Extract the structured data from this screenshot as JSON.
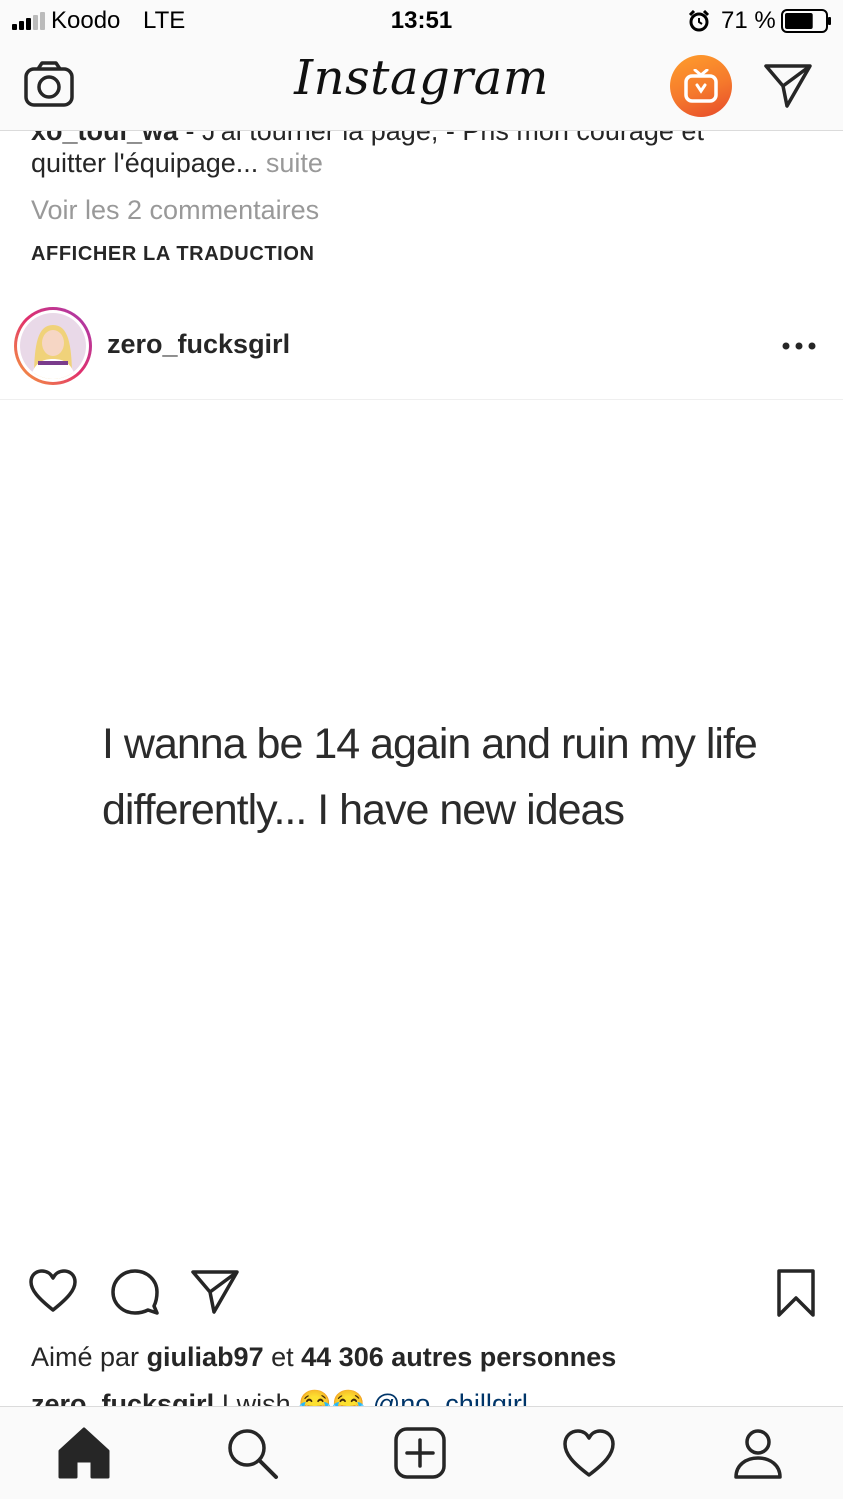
{
  "status_bar": {
    "carrier": "Koodo",
    "network": "LTE",
    "time": "13:51",
    "battery_percent": "71 %",
    "battery_level": 0.71,
    "icons": [
      "signal-icon",
      "alarm-icon",
      "battery-icon"
    ]
  },
  "header": {
    "title": "Instagram",
    "icons": [
      "camera-icon",
      "igtv-icon",
      "direct-message-icon"
    ],
    "igtv_color": "#f5792c"
  },
  "previous_post": {
    "cut_username": "xo_toui_wa",
    "cut_text": " - J'ai tourner la page, - Pris mon courage et",
    "caption_line": "quitter l'équipage...",
    "more_label": "suite",
    "view_comments": "Voir les 2 commentaires",
    "translate_label": "AFFICHER LA TRADUCTION"
  },
  "post": {
    "username": "zero_fucksgirl",
    "options_icon": "more-options-icon",
    "image_text_line1": "I wanna be 14 again and ruin my life",
    "image_text_line2": "differently... I have new ideas",
    "liked_by_prefix": "Aimé par",
    "liked_by_user": "giuliab97",
    "liked_by_mid": "et",
    "liked_by_count": "44 306 autres personnes",
    "caption_username": "zero_fucksgirl",
    "caption_text": " I wish 😂😂 ",
    "caption_mention": "@no_chillgirl"
  },
  "action_icons": [
    "like-icon",
    "comment-icon",
    "share-icon",
    "save-icon"
  ],
  "tab_bar": {
    "icons": [
      "home-icon",
      "search-icon",
      "new-post-icon",
      "activity-icon",
      "profile-icon"
    ]
  }
}
